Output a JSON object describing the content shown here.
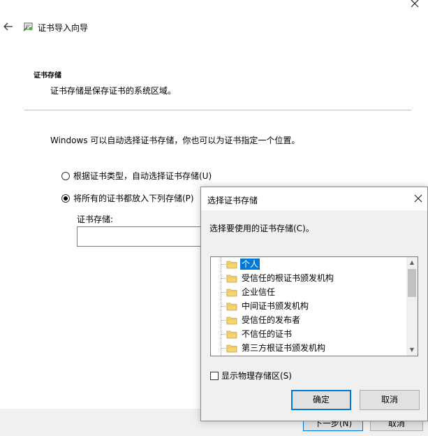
{
  "wizard": {
    "title": "证书导入向导",
    "section_heading": "证书存储",
    "section_desc": "证书存储是保存证书的系统区域。",
    "intro": "Windows 可以自动选择证书存储，你也可以为证书指定一个位置。",
    "radio_auto": "根据证书类型，自动选择证书存储(U)",
    "radio_manual": "将所有的证书都放入下列存储(P)",
    "store_label": "证书存储:",
    "store_value": "",
    "next_button": "下一步(N)",
    "cancel_button": "取消"
  },
  "dialog": {
    "title": "选择证书存储",
    "prompt": "选择要使用的证书存储(C)。",
    "stores": [
      "个人",
      "受信任的根证书颁发机构",
      "企业信任",
      "中间证书颁发机构",
      "受信任的发布者",
      "不信任的证书",
      "第三方根证书颁发机构"
    ],
    "selected_index": 0,
    "show_physical": "显示物理存储区(S)",
    "show_physical_checked": false,
    "ok_button": "确定",
    "cancel_button": "取消"
  },
  "colors": {
    "accent": "#0078d7",
    "folder": "#f5d272"
  }
}
